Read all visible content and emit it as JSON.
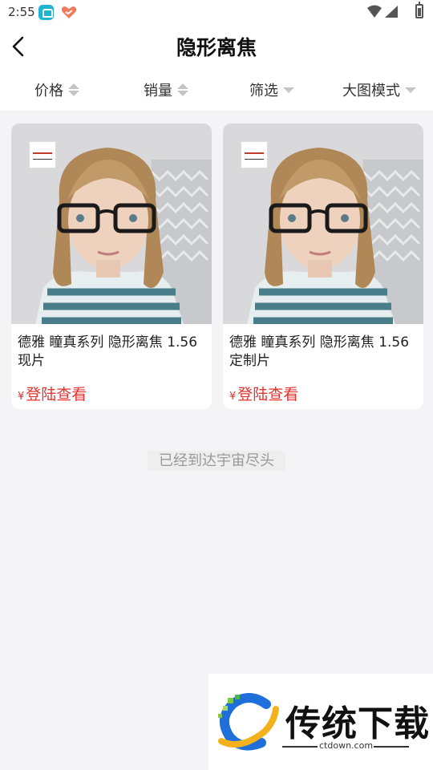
{
  "status_bar": {
    "time": "2:55"
  },
  "header": {
    "title": "隐形离焦"
  },
  "sort_bar": [
    {
      "label": "价格",
      "icon": "sort-arrows-icon"
    },
    {
      "label": "销量",
      "icon": "sort-arrows-icon"
    },
    {
      "label": "筛选",
      "icon": "caret-down-icon"
    },
    {
      "label": "大图模式",
      "icon": "caret-down-icon"
    }
  ],
  "products": [
    {
      "name": "德雅 瞳真系列 隐形离焦 1.56 现片",
      "currency": "¥",
      "price_text": "登陆查看"
    },
    {
      "name": "德雅 瞳真系列 隐形离焦 1.56 定制片",
      "currency": "¥",
      "price_text": "登陆查看"
    }
  ],
  "end_note": "已经到达宇宙尽头",
  "watermark": {
    "title": "传统下载",
    "url": "ctdown.com"
  },
  "colors": {
    "accent_price": "#e3342f",
    "background": "#f4f4f6"
  }
}
